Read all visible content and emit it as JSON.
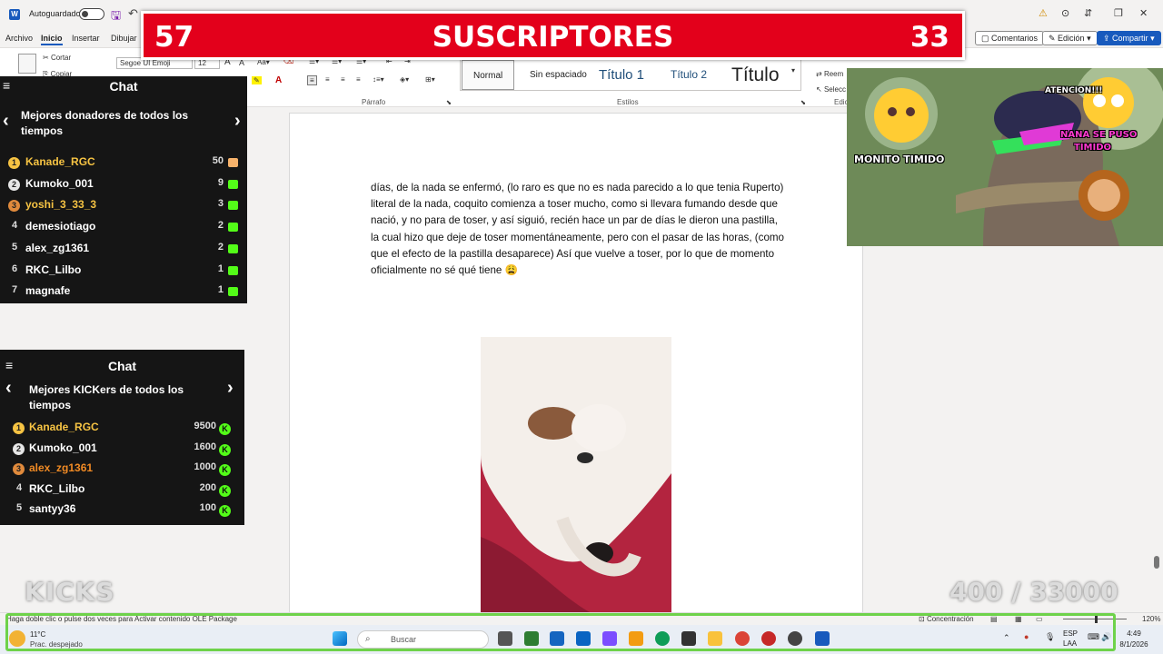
{
  "titlebar": {
    "autosave_label": "Autoguardado"
  },
  "menu": {
    "tabs": [
      "Archivo",
      "Inicio",
      "Insertar",
      "Dibujar"
    ],
    "comments_label": "Comentarios",
    "edit_label": "Edición",
    "share_label": "Compartir"
  },
  "ribbon": {
    "cut_label": "Cortar",
    "copy_label": "Copiar",
    "font_name": "Segoe UI Emoji",
    "font_size": "12",
    "paragraph_label": "Párrafo",
    "styles_label": "Estilos",
    "edit_group_label": "Edic",
    "replace_label": "Reem",
    "select_label": "Selecc",
    "styles": [
      "Normal",
      "Sin espaciado",
      "Título 1",
      "Título 2",
      "Título"
    ]
  },
  "document": {
    "paragraph": "días, de la nada se enfermó, (lo raro es que no es nada parecido a lo que tenia Ruperto) literal de la nada, coquito comienza a toser mucho, como si llevara fumando desde que nació, y no para de toser, y así siguió, recién hace un par de días le dieron una pastilla, la cual hizo que deje de toser momentáneamente, pero con el pasar de las horas, (como que el efecto de la pastilla desaparece) Así que vuelve a toser, por lo que de momento oficialmente no sé qué tiene 😩"
  },
  "statusbar": {
    "message": "Haga doble clic o pulse dos veces para Activar contenido OLE Package",
    "focus_label": "Concentración",
    "zoom": "120%"
  },
  "taskbar": {
    "weather_temp": "11°C",
    "weather_desc": "Prac. despejado",
    "search_placeholder": "Buscar",
    "lang_1": "ESP",
    "lang_2": "LAA",
    "time": "4:49",
    "date": "8/1/2026"
  },
  "subscriber_banner": {
    "left_count": "57",
    "title": "SUSCRIPTORES",
    "right_count": "33"
  },
  "donors_panel": {
    "chat_title": "Chat",
    "subtitle": "Mejores donadores de todos los tiempos",
    "entries": [
      {
        "rank": "1",
        "name": "Kanade_RGC",
        "value": "50",
        "color": "#f6c343"
      },
      {
        "rank": "2",
        "name": "Kumoko_001",
        "value": "9",
        "color": "#ffffff"
      },
      {
        "rank": "3",
        "name": "yoshi_3_33_3",
        "value": "3",
        "color": "#f6c343"
      },
      {
        "rank": "4",
        "name": "demesiotiago",
        "value": "2",
        "color": "#ffffff"
      },
      {
        "rank": "5",
        "name": "alex_zg1361",
        "value": "2",
        "color": "#ffffff"
      },
      {
        "rank": "6",
        "name": "RKC_Lilbo",
        "value": "1",
        "color": "#ffffff"
      },
      {
        "rank": "7",
        "name": "magnafe",
        "value": "1",
        "color": "#ffffff"
      }
    ]
  },
  "kickers_panel": {
    "chat_title": "Chat",
    "subtitle": "Mejores KICKers de todos los tiempos",
    "entries": [
      {
        "rank": "1",
        "name": "Kanade_RGC",
        "value": "9500",
        "color": "#f6c343"
      },
      {
        "rank": "2",
        "name": "Kumoko_001",
        "value": "1600",
        "color": "#ffffff"
      },
      {
        "rank": "3",
        "name": "alex_zg1361",
        "value": "1000",
        "color": "#f08a24"
      },
      {
        "rank": "4",
        "name": "RKC_Lilbo",
        "value": "200",
        "color": "#ffffff"
      },
      {
        "rank": "5",
        "name": "santyy36",
        "value": "100",
        "color": "#ffffff"
      }
    ]
  },
  "kicks_goal": {
    "label": "KICKS",
    "progress": "400 / 33000"
  },
  "cam_overlay": {
    "caption_left": "MONITO TIMIDO",
    "caption_top": "ATENCION!!!",
    "caption_right_1": "NANA SE PUSO",
    "caption_right_2": "TIMIDO"
  },
  "colors": {
    "brand_red": "#e3001b",
    "kick_green": "#53fc18",
    "word_blue": "#185abd"
  }
}
